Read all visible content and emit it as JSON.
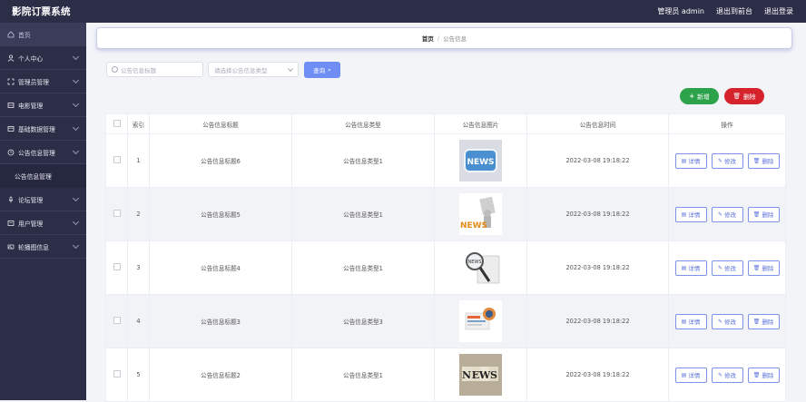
{
  "app": {
    "title": "影院订票系统"
  },
  "topbar": {
    "admin": "管理员 admin",
    "front": "退出到前台",
    "logout": "退出登录"
  },
  "sidebar": {
    "items": [
      {
        "label": "首页",
        "icon": "home-icon",
        "expandable": false
      },
      {
        "label": "个人中心",
        "icon": "user-icon",
        "expandable": true
      },
      {
        "label": "管理员管理",
        "icon": "expand-icon",
        "expandable": true
      },
      {
        "label": "电影管理",
        "icon": "film-icon",
        "expandable": true
      },
      {
        "label": "基础数据管理",
        "icon": "grid-icon",
        "expandable": true
      },
      {
        "label": "公告信息管理",
        "icon": "clock-icon",
        "expandable": true
      },
      {
        "label": "公告信息管理",
        "icon": "",
        "expandable": false,
        "sub": true
      },
      {
        "label": "论坛管理",
        "icon": "mic-icon",
        "expandable": true
      },
      {
        "label": "用户管理",
        "icon": "users-icon",
        "expandable": true
      },
      {
        "label": "轮播图信息",
        "icon": "image-icon",
        "expandable": true
      }
    ]
  },
  "breadcrumb": {
    "home": "首页",
    "sep": "/",
    "current": "公告信息"
  },
  "search": {
    "placeholder": "公告信息标题",
    "select_placeholder": "请选择公告信息类型",
    "query": "查询"
  },
  "actions": {
    "add": "新增",
    "delete": "删除"
  },
  "table": {
    "headers": [
      "",
      "索引",
      "公告信息标题",
      "公告信息类型",
      "公告信息图片",
      "公告信息时间",
      "操作"
    ],
    "op_labels": {
      "detail": "详情",
      "edit": "修改",
      "delete": "删除"
    },
    "rows": [
      {
        "index": "1",
        "title": "公告信息标题6",
        "type": "公告信息类型1",
        "time": "2022-03-08 19:18:22",
        "image": "news-button"
      },
      {
        "index": "2",
        "title": "公告信息标题5",
        "type": "公告信息类型1",
        "time": "2022-03-08 19:18:22",
        "image": "news-figure"
      },
      {
        "index": "3",
        "title": "公告信息标题4",
        "type": "公告信息类型1",
        "time": "2022-03-08 19:18:22",
        "image": "news-magnifier"
      },
      {
        "index": "4",
        "title": "公告信息标题3",
        "type": "公告信息类型3",
        "time": "2022-03-08 19:18:22",
        "image": "news-papers"
      },
      {
        "index": "5",
        "title": "公告信息标题2",
        "type": "公告信息类型1",
        "time": "2022-03-08 19:18:22",
        "image": "news-letters"
      }
    ]
  },
  "colors": {
    "sidebar": "#2c2e48",
    "primary": "#6f8ef5",
    "success": "#2ca34a",
    "danger": "#d5222b"
  }
}
